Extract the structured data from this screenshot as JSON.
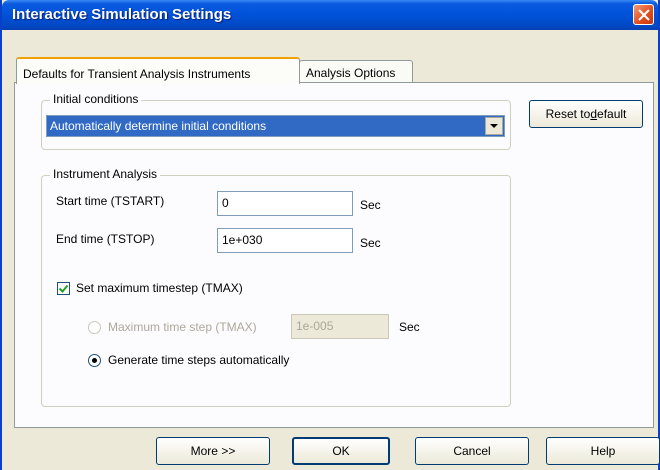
{
  "window": {
    "title": "Interactive Simulation Settings"
  },
  "tabs": [
    {
      "label": "Defaults for Transient Analysis Instruments",
      "active": true
    },
    {
      "label": "Analysis Options",
      "active": false
    }
  ],
  "initial_conditions": {
    "group_title": "Initial conditions",
    "selected": "Automatically determine initial conditions"
  },
  "reset_button": {
    "label_pre": "Reset to ",
    "label_accel": "d",
    "label_post": "efault"
  },
  "instrument_analysis": {
    "group_title": "Instrument Analysis",
    "start_time": {
      "label": "Start time (TSTART)",
      "value": "0",
      "unit": "Sec"
    },
    "end_time": {
      "label": "End time (TSTOP)",
      "value": "1e+030",
      "unit": "Sec"
    },
    "set_tmax": {
      "label": "Set maximum timestep (TMAX)",
      "checked": true
    },
    "max_step": {
      "label": "Maximum time step (TMAX)",
      "value": "1e-005",
      "unit": "Sec",
      "selected": false,
      "enabled": false
    },
    "auto_step": {
      "label": "Generate time steps automatically",
      "selected": true
    }
  },
  "buttons": {
    "more": "More >>",
    "ok": "OK",
    "cancel": "Cancel",
    "help": "Help"
  },
  "colors": {
    "titlebar": "#0052d9",
    "dialog_bg": "#ece9d8",
    "selection": "#316ac5",
    "close": "#e04b1b"
  }
}
